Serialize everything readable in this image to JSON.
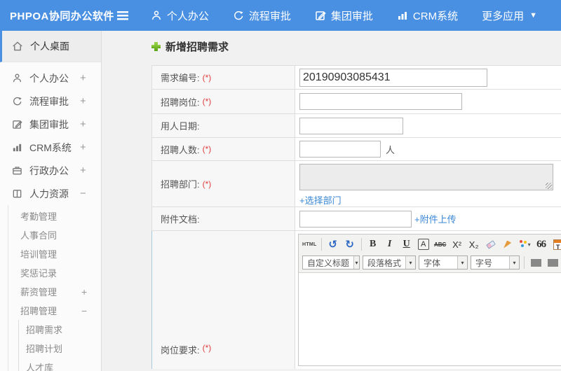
{
  "topbar": {
    "brand": "PHPOA协同办公软件",
    "menu": [
      {
        "label": "个人办公"
      },
      {
        "label": "流程审批"
      },
      {
        "label": "集团审批"
      },
      {
        "label": "CRM系统"
      },
      {
        "label": "更多应用"
      }
    ]
  },
  "sidebar": {
    "items": [
      {
        "label": "个人桌面"
      },
      {
        "label": "个人办公",
        "expand": "+"
      },
      {
        "label": "流程审批",
        "expand": "+"
      },
      {
        "label": "集团审批",
        "expand": "+"
      },
      {
        "label": "CRM系统",
        "expand": "+"
      },
      {
        "label": "行政办公",
        "expand": "+"
      },
      {
        "label": "人力资源",
        "expand": "−"
      }
    ],
    "hr_children": [
      {
        "label": "考勤管理"
      },
      {
        "label": "人事合同"
      },
      {
        "label": "培训管理"
      },
      {
        "label": "奖惩记录"
      },
      {
        "label": "薪资管理",
        "expand": "+"
      },
      {
        "label": "招聘管理",
        "expand": "−"
      }
    ],
    "recruit_children": [
      {
        "label": "招聘需求"
      },
      {
        "label": "招聘计划"
      },
      {
        "label": "人才库"
      }
    ]
  },
  "main": {
    "title": "新增招聘需求",
    "form": {
      "rows": [
        {
          "label": "需求编号:",
          "required": "(*)",
          "value": "20190903085431"
        },
        {
          "label": "招聘岗位:",
          "required": "(*)",
          "value": ""
        },
        {
          "label": "用人日期:",
          "required": "",
          "value": ""
        },
        {
          "label": "招聘人数:",
          "required": "(*)",
          "value": "",
          "suffix": "人"
        },
        {
          "label": "招聘部门:",
          "required": "(*)",
          "link": "+选择部门"
        },
        {
          "label": "附件文档:",
          "required": "",
          "value": "",
          "link": "+附件上传"
        },
        {
          "label": "岗位要求:",
          "required": "(*)"
        }
      ]
    },
    "editor": {
      "toolbar": {
        "html": "HTML",
        "undo": "↺",
        "redo": "↻",
        "bold": "B",
        "italic": "I",
        "underline": "U",
        "box_a": "A",
        "strike": "ABC",
        "sup": "X²",
        "sub": "X₂",
        "quote": "66",
        "paste": "T",
        "fontcolor": "A",
        "hilite": "ab",
        "caret": "▾"
      },
      "selects": [
        {
          "label": "自定义标题"
        },
        {
          "label": "段落格式"
        },
        {
          "label": "字体"
        },
        {
          "label": "字号"
        }
      ]
    }
  },
  "colors": {
    "navbar": "#4a90e2",
    "link": "#3a87d6",
    "required": "#e23c3c",
    "accent_border": "#a9c9de"
  }
}
